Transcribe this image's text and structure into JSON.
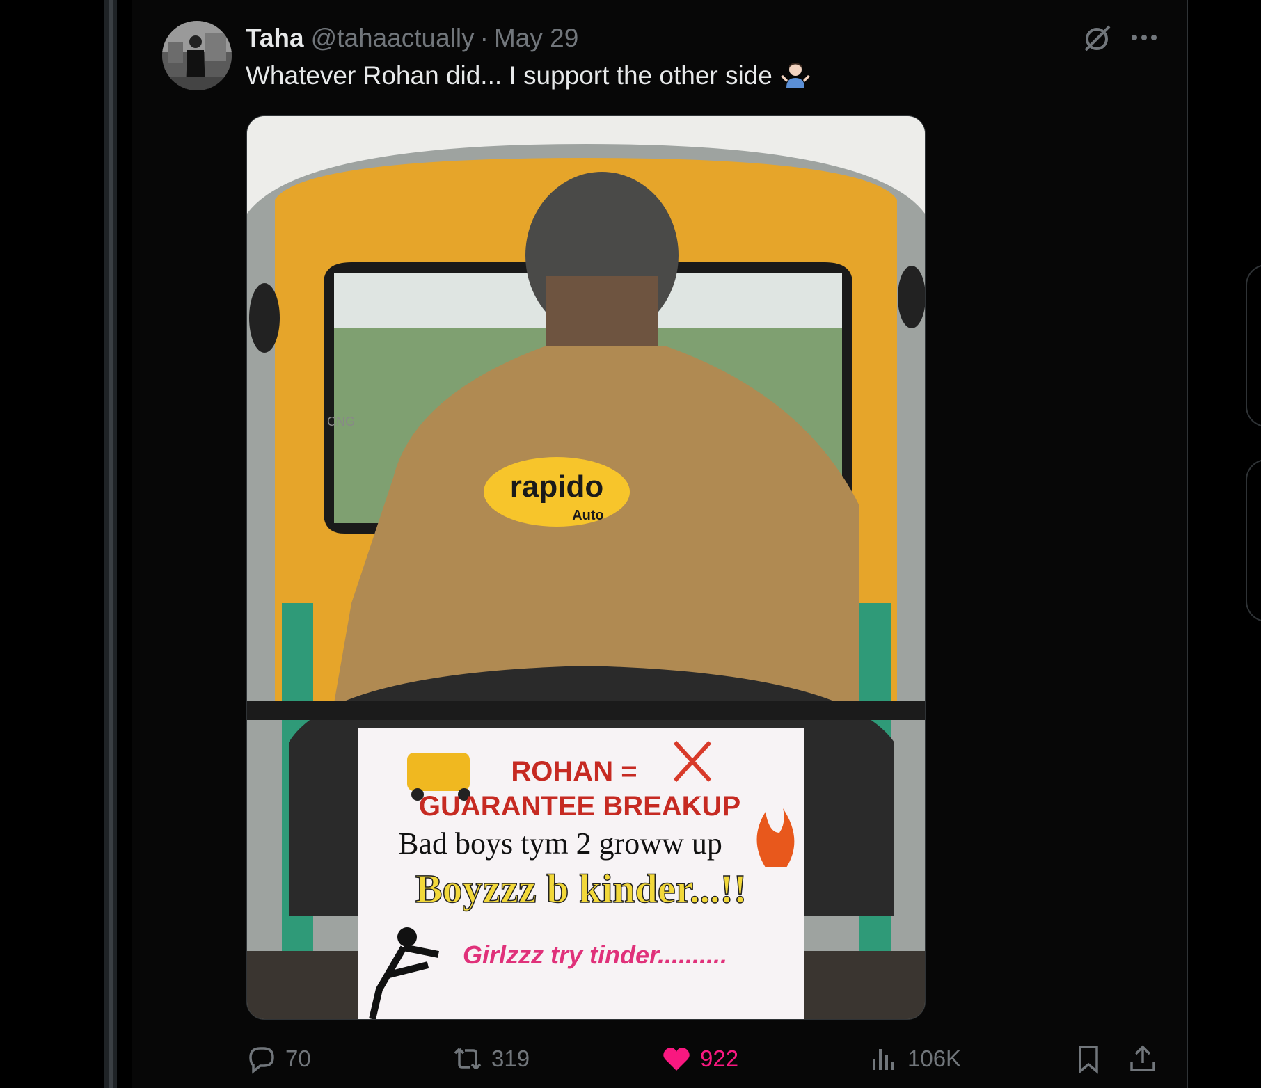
{
  "tweet": {
    "author_name": "Taha",
    "handle": "@tahaactually",
    "separator": "·",
    "date": "May 29",
    "text": "Whatever Rohan did... I support the other side"
  },
  "media": {
    "jacket_brand": "rapido",
    "jacket_sub": "Auto",
    "sign_line1": "ROHAN =",
    "sign_line2": "GUARANTEE BREAKUP",
    "sign_line3": "Bad boys tym 2 groww up",
    "sign_line4": "Boyzzz b kinder...!!",
    "sign_line5": "Girlzzz try tinder..........",
    "cng_label": "CNG"
  },
  "actions": {
    "replies": "70",
    "reposts": "319",
    "likes": "922",
    "views": "106K"
  },
  "icons": {
    "reply": "reply-icon",
    "repost": "repost-icon",
    "like": "heart-icon",
    "views": "views-icon",
    "bookmark": "bookmark-icon",
    "share": "share-icon",
    "grok": "grok-icon",
    "more": "more-icon"
  },
  "colors": {
    "background": "#000000",
    "text": "#e7e9ea",
    "muted": "#71767b",
    "like": "#f91880"
  }
}
